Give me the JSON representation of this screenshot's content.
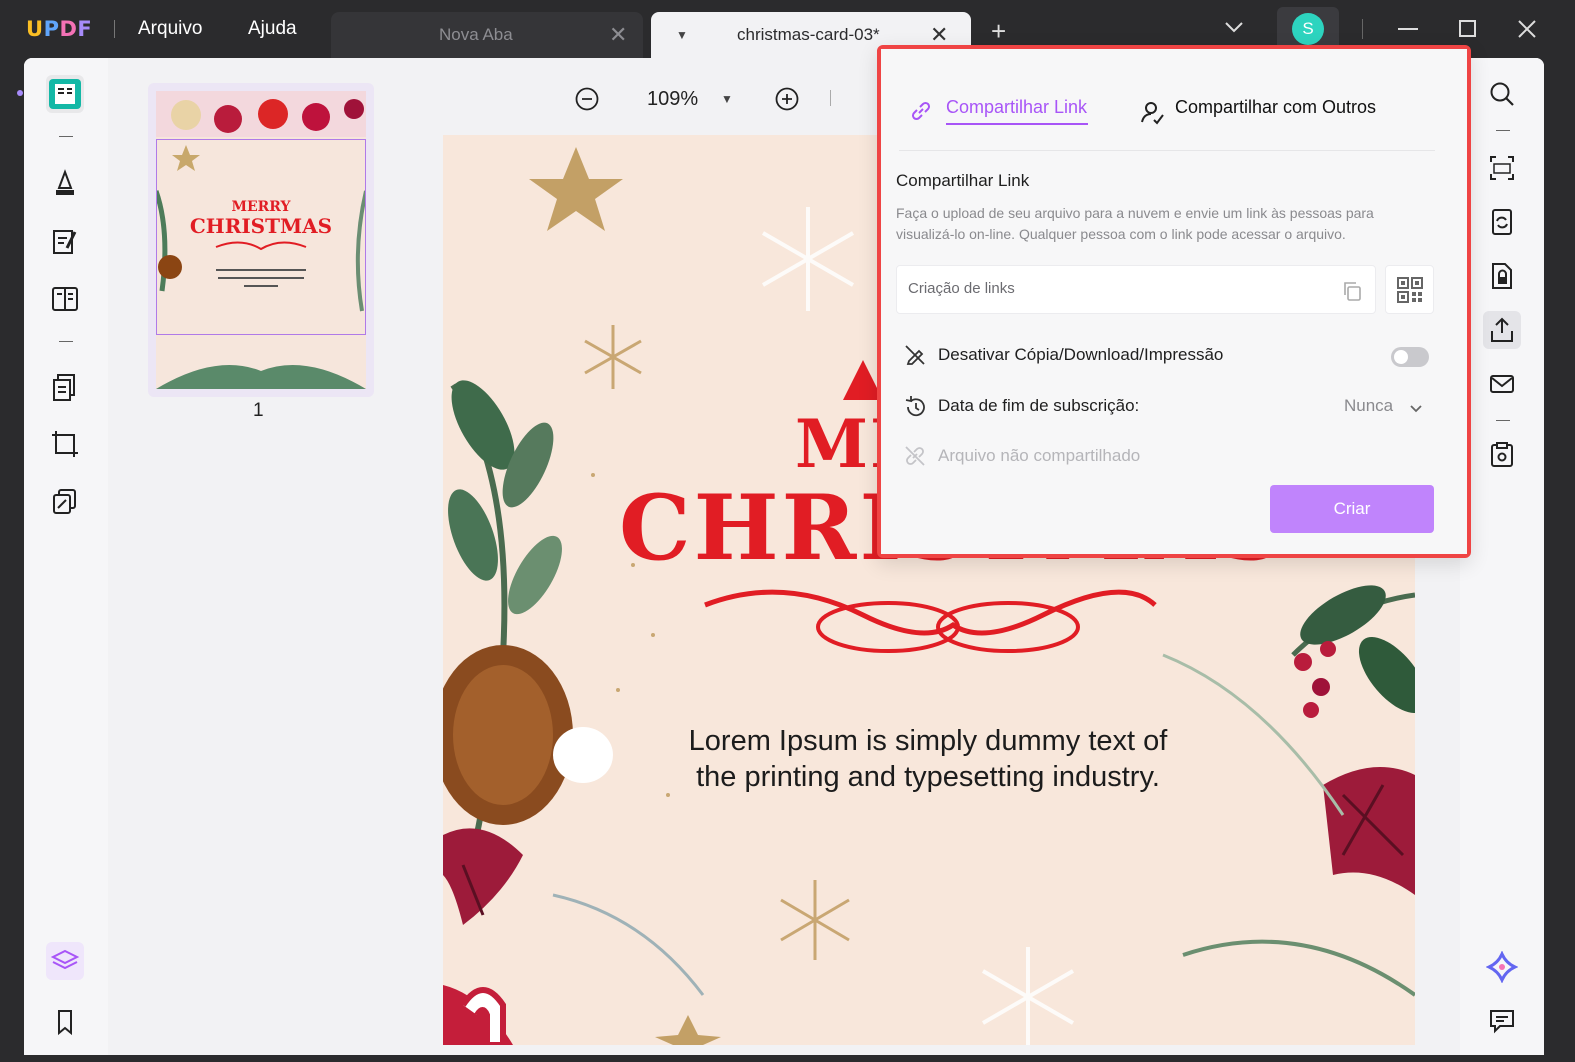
{
  "app": {
    "logo": {
      "l1": "U",
      "l2": "P",
      "l3": "D",
      "l4": "F"
    },
    "menu": {
      "file": "Arquivo",
      "help": "Ajuda"
    },
    "tabs": [
      {
        "label": "Nova Aba",
        "active": false
      },
      {
        "label": "christmas-card-03*",
        "active": true
      }
    ],
    "user_initial": "S"
  },
  "viewer": {
    "zoom": "109%",
    "page_number": "1",
    "page": {
      "title_line1": "MERRY",
      "title_line2": "CHRISTMAS",
      "body": "Lorem Ipsum is simply dummy text of the printing and typesetting industry."
    }
  },
  "share_popup": {
    "tabs": {
      "share_link": "Compartilhar Link",
      "share_others": "Compartilhar com Outros"
    },
    "heading": "Compartilhar Link",
    "description": "Faça o upload de seu arquivo para a nuvem e envie um link às pessoas para visualizá-lo on-line. Qualquer pessoa com o link pode acessar o arquivo.",
    "link_placeholder": "Criação de links",
    "disable_copy_label": "Desativar Cópia/Download/Impressão",
    "disable_copy_enabled": false,
    "expiry_label": "Data de fim de subscrição:",
    "expiry_value": "Nunca",
    "status_label": "Arquivo não compartilhado",
    "create_button": "Criar"
  },
  "colors": {
    "accent": "#a855f7",
    "button": "#c084fc",
    "highlight_border": "#ef4444",
    "card_red": "#e11d24"
  }
}
